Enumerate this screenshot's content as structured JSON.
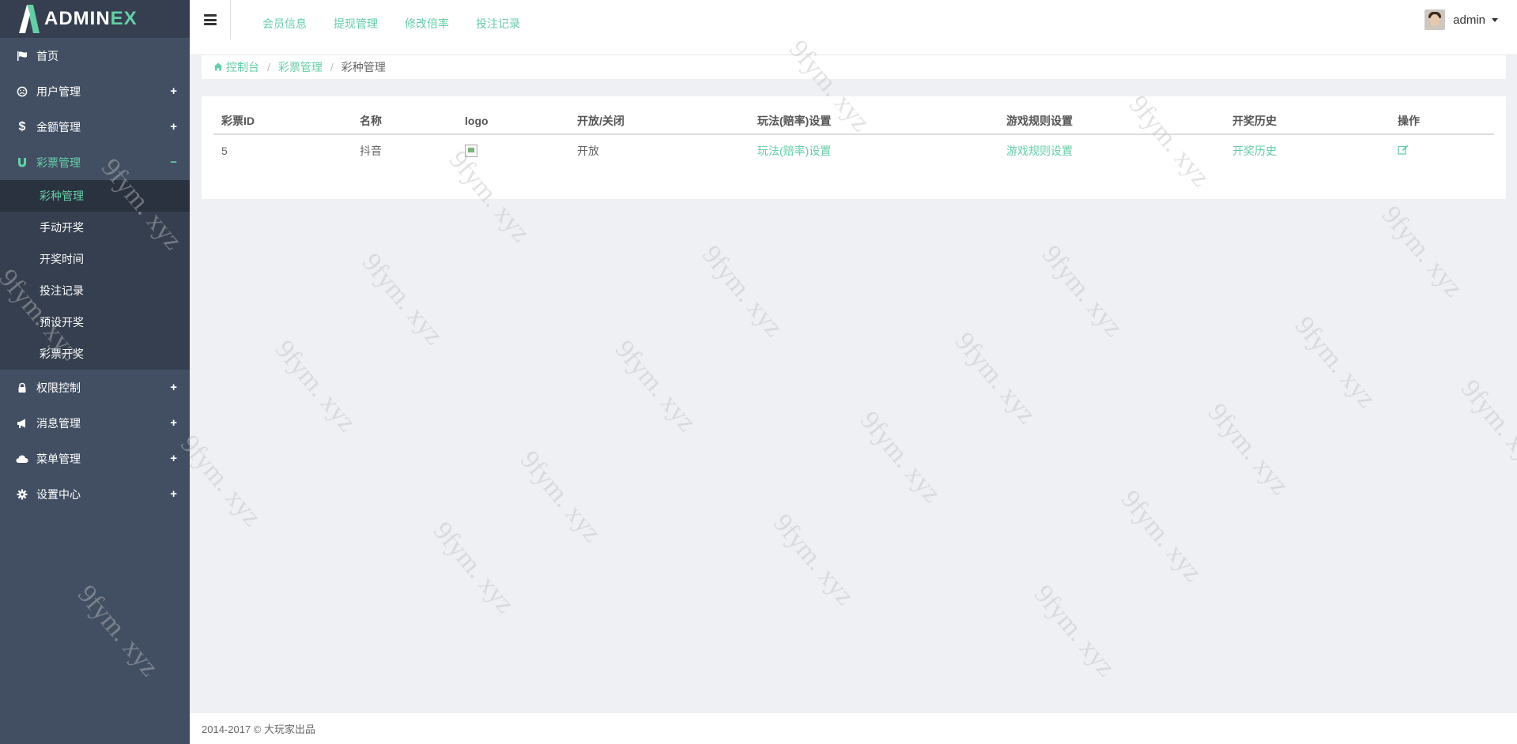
{
  "app": {
    "logo_text_main": "ADMIN",
    "logo_text_accent": "EX",
    "accent_color": "#65cea7",
    "sidebar_bg": "#424f63"
  },
  "sidebar": {
    "items": [
      {
        "label": "首页",
        "icon": "flag-icon"
      },
      {
        "label": "用户管理",
        "icon": "smile-icon",
        "expander": "+"
      },
      {
        "label": "金额管理",
        "icon": "dollar-icon",
        "expander": "+"
      },
      {
        "label": "彩票管理",
        "icon": "magnet-icon",
        "expander": "−"
      },
      {
        "label": "权限控制",
        "icon": "lock-icon",
        "expander": "+"
      },
      {
        "label": "消息管理",
        "icon": "bullhorn-icon",
        "expander": "+"
      },
      {
        "label": "菜单管理",
        "icon": "cloud-icon",
        "expander": "+"
      },
      {
        "label": "设置中心",
        "icon": "gear-icon",
        "expander": "+"
      }
    ],
    "submenu": [
      {
        "label": "彩种管理"
      },
      {
        "label": "手动开奖"
      },
      {
        "label": "开奖时间"
      },
      {
        "label": "投注记录"
      },
      {
        "label": "预设开奖"
      },
      {
        "label": "彩票开奖"
      }
    ]
  },
  "header": {
    "top_links": [
      "会员信息",
      "提现管理",
      "修改倍率",
      "投注记录"
    ],
    "username": "admin"
  },
  "breadcrumb": {
    "home": "控制台",
    "parent": "彩票管理",
    "current": "彩种管理",
    "separator": "/"
  },
  "table": {
    "headers": [
      "彩票ID",
      "名称",
      "logo",
      "开放/关闭",
      "玩法(赔率)设置",
      "游戏规则设置",
      "开奖历史",
      "操作"
    ],
    "rows": [
      {
        "id": "5",
        "name": "抖音",
        "status": "开放",
        "odds_link": "玩法(赔率)设置",
        "rules_link": "游戏规则设置",
        "history_link": "开奖历史"
      }
    ]
  },
  "footer": {
    "text": "2014-2017 © 大玩家出品"
  },
  "watermark": {
    "text": "9fym. xyz"
  }
}
